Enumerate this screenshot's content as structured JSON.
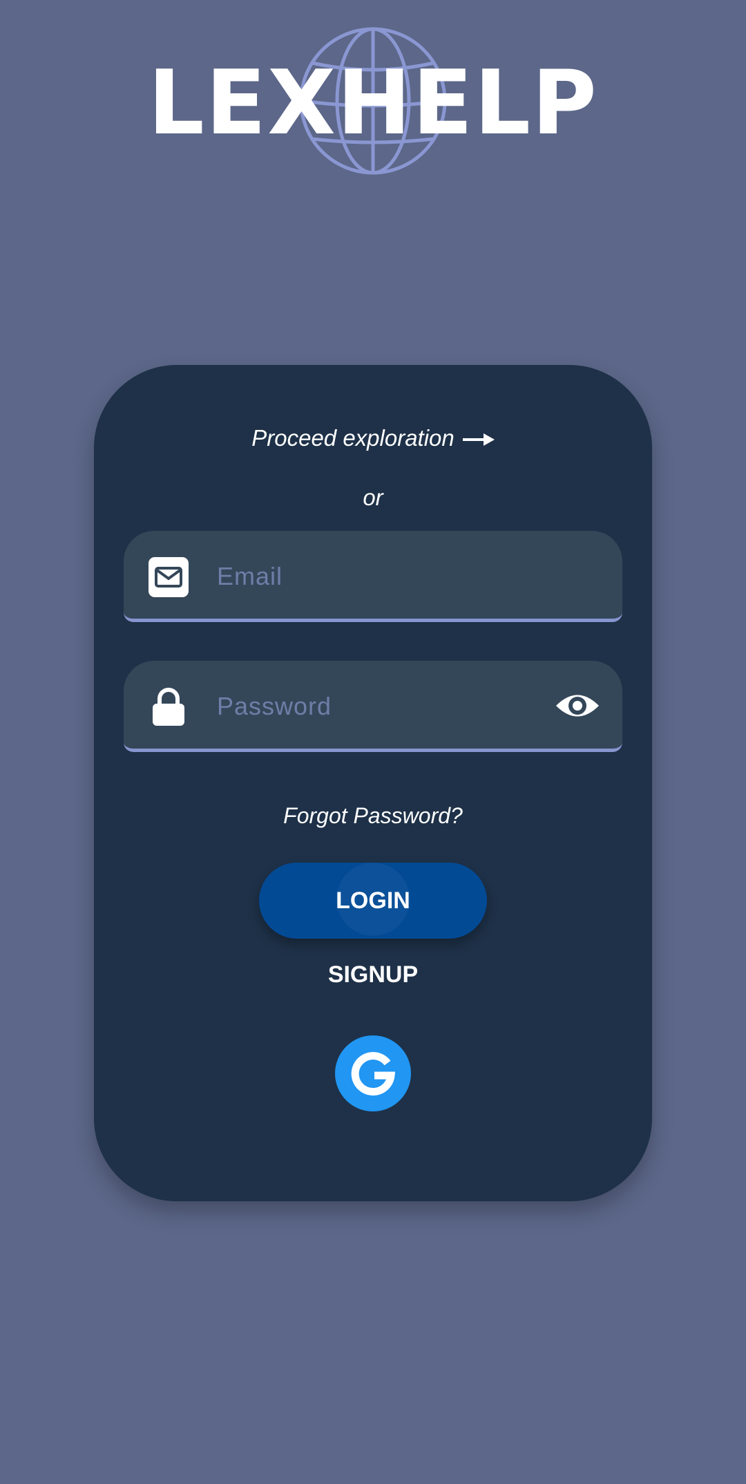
{
  "app": {
    "name": "LEXHELP"
  },
  "card": {
    "proceed_label": "Proceed exploration",
    "or_label": "or",
    "email": {
      "placeholder": "Email",
      "value": ""
    },
    "password": {
      "placeholder": "Password",
      "value": ""
    },
    "forgot_label": "Forgot Password?",
    "login_label": "LOGIN",
    "signup_label": "SIGNUP"
  },
  "icons": {
    "logo_globe": "globe-icon",
    "proceed": "arrow-right-icon",
    "email": "mail-icon",
    "password": "lock-icon",
    "toggle_visibility": "eye-icon",
    "google": "google-icon"
  },
  "colors": {
    "background": "#5c6789",
    "card": "#1e3148",
    "field": "#344759",
    "field_underline": "#8796d0",
    "placeholder": "#6e7ea8",
    "login_button": "#034a95",
    "google_button": "#2196f3",
    "globe": "#8a97d2"
  }
}
